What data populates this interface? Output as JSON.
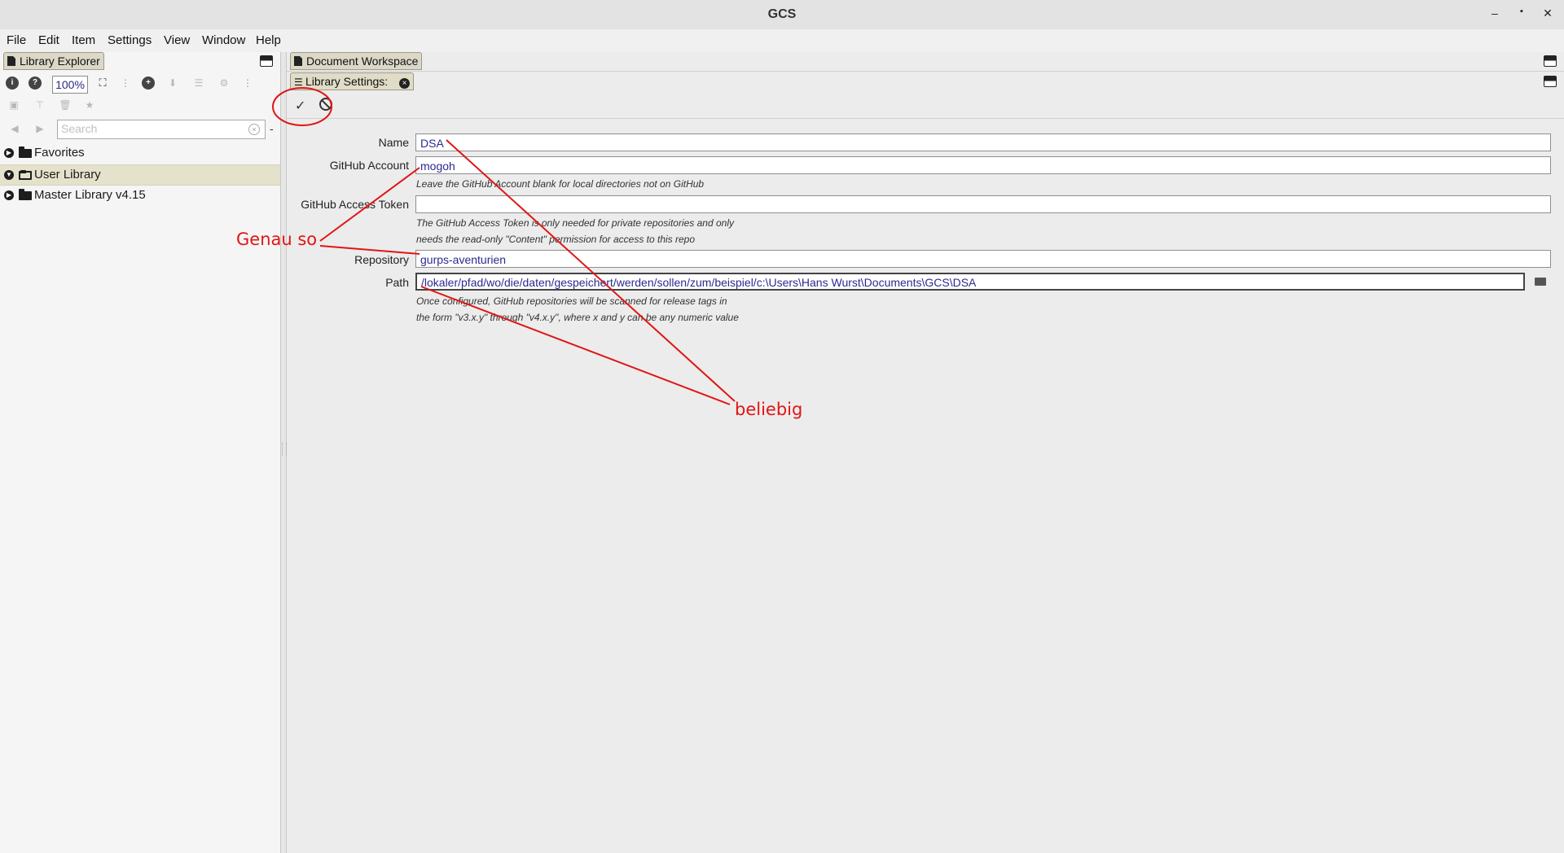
{
  "window": {
    "title": "GCS"
  },
  "menu": [
    "File",
    "Edit",
    "Item",
    "Settings",
    "View",
    "Window",
    "Help"
  ],
  "left": {
    "tab": "Library Explorer",
    "zoom": "100%",
    "search_placeholder": "Search",
    "dash": "-",
    "tree": [
      {
        "label": "Favorites",
        "expanded": false
      },
      {
        "label": "User Library",
        "expanded": true,
        "selected": true
      },
      {
        "label": "Master Library v4.15",
        "expanded": false
      }
    ]
  },
  "right": {
    "tab_workspace": "Document Workspace",
    "tab_settings": "Library Settings:",
    "form": {
      "name_label": "Name",
      "name_value": "DSA",
      "github_account_label": "GitHub Account",
      "github_account_value": "mogoh",
      "github_account_hint": "Leave the GitHub Account blank for local directories not on GitHub",
      "token_label": "GitHub Access Token",
      "token_value": "",
      "token_hint_1": "The GitHub Access Token is only needed for private repositories and only",
      "token_hint_2": "needs the read-only \"Content\" permission for access to this repo",
      "repository_label": "Repository",
      "repository_value": "gurps-aventurien",
      "path_label": "Path",
      "path_value": "/lokaler/pfad/wo/die/daten/gespeichert/werden/sollen/zum/beispiel/c:\\Users\\Hans Wurst\\Documents\\GCS\\DSA",
      "path_hint_1": "Once configured, GitHub repositories will be scanned for release tags in",
      "path_hint_2": "the form \"v3.x.y\" through \"v4.x.y\", where x and y can be any numeric value"
    }
  },
  "annotations": {
    "genau": "Genau so",
    "beliebig": "beliebig",
    "color": "#e01515"
  }
}
